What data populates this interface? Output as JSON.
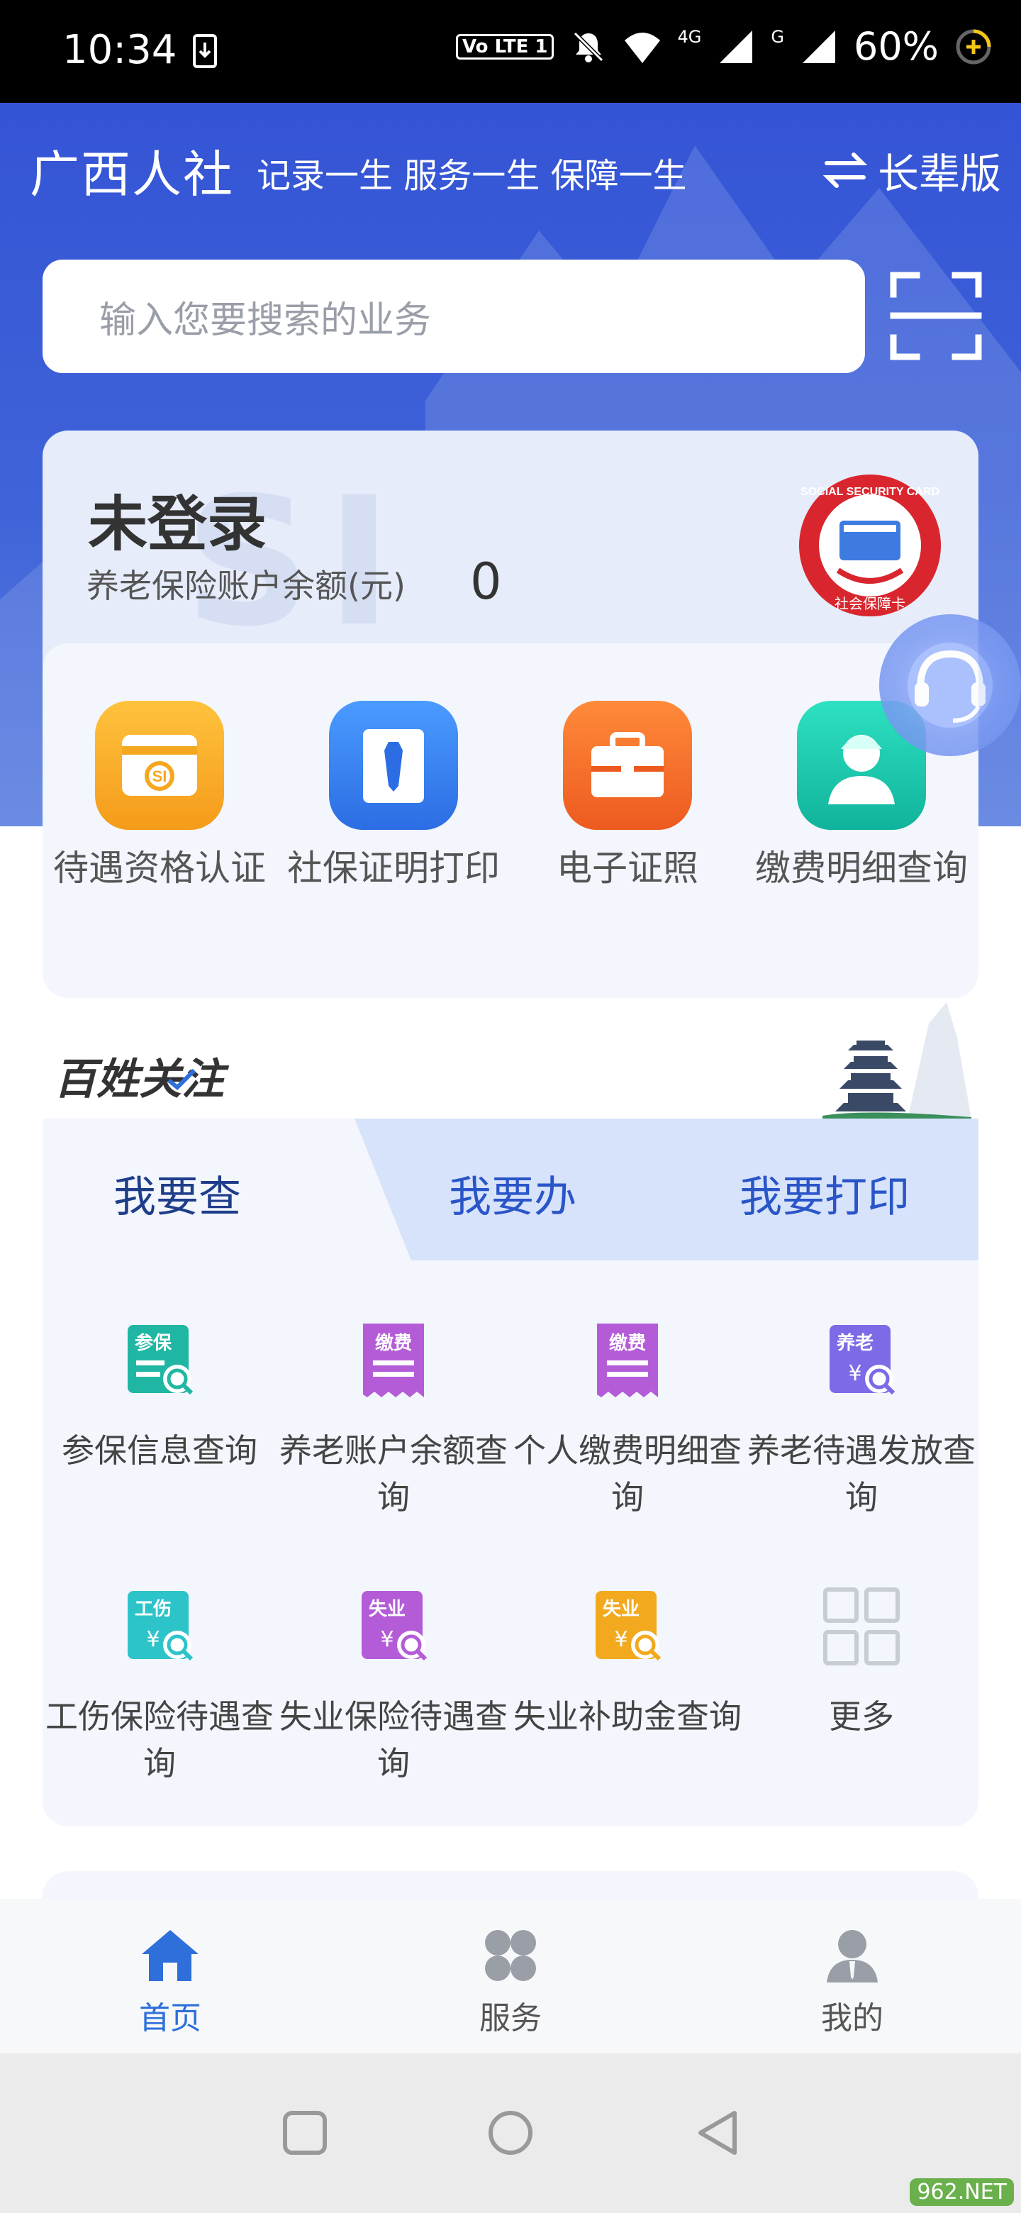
{
  "status_bar": {
    "time": "10:34",
    "network": "4G",
    "network2": "G",
    "volte": "Vo LTE 1",
    "battery": "60%"
  },
  "header": {
    "brand": "广西人社",
    "slogan": "记录一生 服务一生 保障一生",
    "elder_mode": "长辈版"
  },
  "search": {
    "placeholder": "输入您要搜索的业务"
  },
  "account": {
    "status": "未登录",
    "balance_label": "养老保险账户余额(元)",
    "balance_value": "0",
    "watermark": "SI CARD",
    "logo_text": "SOCIAL SECURITY CARD",
    "logo_sub": "社会保障卡"
  },
  "quick_actions": [
    {
      "label": "待遇资格认证",
      "icon": "si-card-icon",
      "color": "#fbb12a"
    },
    {
      "label": "社保证明打印",
      "icon": "certificate-tie-icon",
      "color": "#3a86f0"
    },
    {
      "label": "电子证照",
      "icon": "briefcase-icon",
      "color": "#f2742a"
    },
    {
      "label": "缴费明细查询",
      "icon": "worker-icon",
      "color": "#1fc3a8"
    }
  ],
  "concern": {
    "title": "百姓关注",
    "tabs": [
      "我要查",
      "我要办",
      "我要打印"
    ],
    "active_tab": 0,
    "items": [
      {
        "label": "参保信息查询",
        "badge": "参保",
        "color": "#1fb7a3",
        "icon": "insured-query-icon"
      },
      {
        "label": "养老账户余额查询",
        "badge": "缴费",
        "color": "#b45cd8",
        "icon": "payment-receipt-icon"
      },
      {
        "label": "个人缴费明细查询",
        "badge": "缴费",
        "color": "#b45cd8",
        "icon": "payment-receipt-icon"
      },
      {
        "label": "养老待遇发放查询",
        "badge": "养老",
        "color": "#7b6be6",
        "icon": "pension-query-icon"
      },
      {
        "label": "工伤保险待遇查询",
        "badge": "工伤",
        "color": "#2cc4c9",
        "icon": "injury-query-icon"
      },
      {
        "label": "失业保险待遇查询",
        "badge": "失业",
        "color": "#b45cd8",
        "icon": "unemployment-query-icon"
      },
      {
        "label": "失业补助金查询",
        "badge": "失业",
        "color": "#f2a91e",
        "icon": "subsidy-query-icon"
      },
      {
        "label": "更多",
        "badge": "",
        "color": "#c8ccd4",
        "icon": "grid-more-icon"
      }
    ]
  },
  "bottom_nav": [
    {
      "label": "首页",
      "icon": "home-icon",
      "active": true
    },
    {
      "label": "服务",
      "icon": "services-icon",
      "active": false
    },
    {
      "label": "我的",
      "icon": "profile-icon",
      "active": false
    }
  ],
  "colors": {
    "primary": "#3454d6",
    "active_nav": "#2e6fd9",
    "inactive_nav": "#555555"
  },
  "watermark_site": "962.NET"
}
